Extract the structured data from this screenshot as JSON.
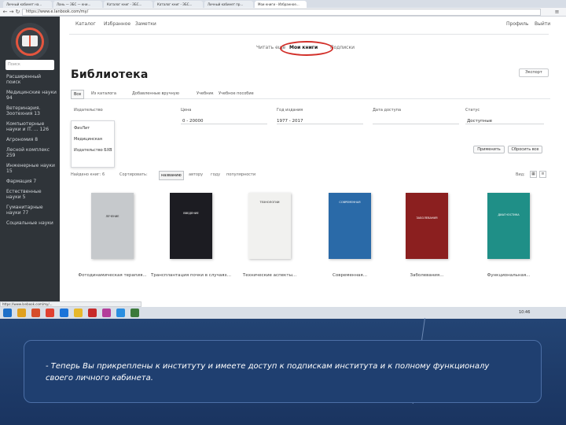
{
  "browser": {
    "tabs": [
      {
        "label": "Личный кабинет на..."
      },
      {
        "label": "Лань — ЭБС — кни..."
      },
      {
        "label": "Каталог книг - ЭБС..."
      },
      {
        "label": "Каталог книг - ЭБС..."
      },
      {
        "label": "Личный кабинет пр..."
      },
      {
        "label": "Мои книги - Избранное..."
      }
    ],
    "url": "https://www.e.lanbook.com/my/"
  },
  "sidebar": {
    "search_placeholder": "Поиск",
    "items": [
      "Расширенный поиск",
      "Медицинские науки 94",
      "Ветеринария. Зоотехния 13",
      "Компьютерные науки и IT. ... 126",
      "Агрономия 8",
      "Лесной комплекс 259",
      "Инженерные науки 15",
      "Фармация 7",
      "Естественные науки 5",
      "Гуманитарные науки 77",
      "Социальные науки"
    ]
  },
  "topnav": {
    "items": [
      "Каталог",
      "Избранное",
      "Заметки"
    ],
    "right_items": [
      "Профиль",
      "Выйти"
    ]
  },
  "subtabs": [
    {
      "label": "Читать ещё",
      "active": false
    },
    {
      "label": "Мои книги",
      "active": true
    },
    {
      "label": "Подписки",
      "active": false
    }
  ],
  "page_title": "Библиотека",
  "export_label": "Экспорт",
  "category_tabs": [
    {
      "label": "Все",
      "active": true
    },
    {
      "label": "Из каталога",
      "active": false
    },
    {
      "label": "Добавленные вручную",
      "active": false
    },
    {
      "label": "Учебник",
      "active": false
    },
    {
      "label": "Учебное пособие",
      "active": false
    }
  ],
  "filters": {
    "publisher_label": "Издательство",
    "price_label": "Цена",
    "year_label": "Год издания",
    "date_label": "Дата доступа",
    "status_label": "Статус",
    "price_value": "0 - 20000",
    "year_value": "1977 - 2017",
    "status_value": "Доступные",
    "publisher_options": [
      "ФизЛит",
      "Медицинская",
      "Издательство БХВ"
    ],
    "apply_label": "Применить",
    "reset_label": "Сбросить все"
  },
  "sortbar": {
    "found_label": "Найдено книг: 6",
    "sort_label": "Сортировать:",
    "sort_options": [
      {
        "label": "названию",
        "active": true
      },
      {
        "label": "автору",
        "active": false
      },
      {
        "label": "году",
        "active": false
      },
      {
        "label": "популярности",
        "active": false
      }
    ],
    "view_label": "Вид:"
  },
  "books": [
    {
      "title": "Фотодинамическая терапия...",
      "cover_color": "#c6c9cc",
      "cover_text": "ЛЕЧЕНИЕ"
    },
    {
      "title": "Трансплантация почки в случаях...",
      "cover_color": "#1c1c22",
      "cover_text": "ВВЕДЕНИЕ"
    },
    {
      "title": "Технические аспекты...",
      "cover_color": "#f1f1ef",
      "cover_text": "ТЕХНОЛОГИИ"
    },
    {
      "title": "Современная...",
      "cover_color": "#2a6aa8",
      "cover_text": "СОВРЕМЕННАЯ"
    },
    {
      "title": "Заболевания...",
      "cover_color": "#8b1f1f",
      "cover_text": "ЗАБОЛЕВАНИЯ"
    },
    {
      "title": "Функциональная...",
      "cover_color": "#1f8f87",
      "cover_text": "ДИАГНОСТИКА"
    }
  ],
  "status_url": "https://www.lanbook.com/my/...",
  "taskbar": {
    "time": "10:46"
  },
  "slide_caption": "- Теперь Вы прикреплены к институту и имеете доступ к подпискам института и к полному функционалу своего личного кабинета."
}
